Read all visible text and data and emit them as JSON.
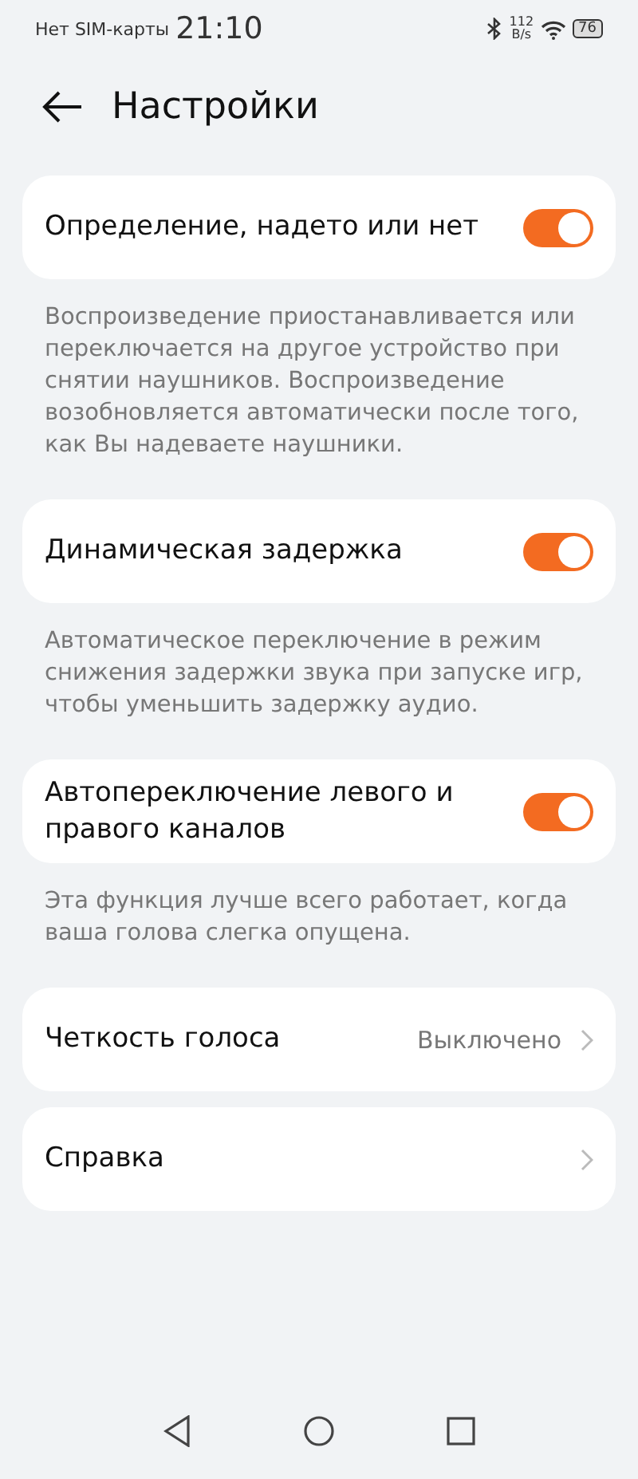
{
  "status_bar": {
    "carrier": "Нет SIM-карты",
    "time": "21:10",
    "speed_value": "112",
    "speed_unit": "B/s",
    "battery": "76"
  },
  "header": {
    "title": "Настройки"
  },
  "sections": [
    {
      "kind": "toggle",
      "label": "Определение, надето или нет",
      "on": true,
      "description": "Воспроизведение приостанавливается или переключается на другое устройство при снятии наушников. Воспроизведение возобновляется автоматически после того, как Вы надеваете наушники."
    },
    {
      "kind": "toggle",
      "label": "Динамическая задержка",
      "on": true,
      "description": "Автоматическое переключение в режим снижения задержки звука при запуске игр, чтобы уменьшить задержку аудио."
    },
    {
      "kind": "toggle",
      "label": "Автопереключение левого и правого каналов",
      "on": true,
      "description": "Эта функция лучше всего работает, когда ваша голова слегка опущена."
    },
    {
      "kind": "link",
      "label": "Четкость голоса",
      "value": "Выключено"
    },
    {
      "kind": "link",
      "label": "Справка"
    }
  ]
}
